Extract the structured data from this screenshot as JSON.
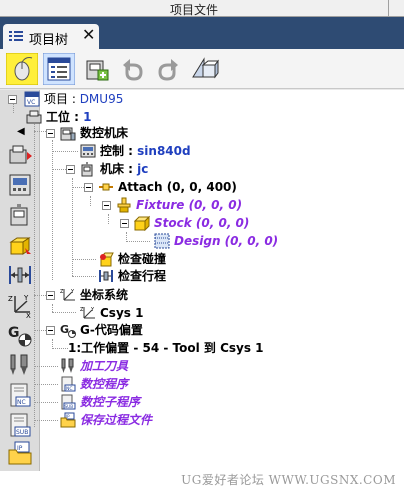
{
  "header": {
    "title": "项目文件"
  },
  "tab": {
    "label": "项目树",
    "close": "✕"
  },
  "toolbar": {
    "buttons": [
      "select-mouse",
      "properties",
      "add-machine",
      "undo",
      "redo",
      "export-3d"
    ]
  },
  "tree": {
    "project": {
      "label": "项目 : ",
      "value": "DMU95"
    },
    "station": {
      "label": "工位 : ",
      "value": "1"
    },
    "cnc_machine": {
      "label": "数控机床"
    },
    "control": {
      "label": "控制 : ",
      "value": "sin840d"
    },
    "machine": {
      "label": "机床 : ",
      "value": "jc"
    },
    "attach": {
      "label": "Attach (0, 0, 400)"
    },
    "fixture": {
      "label": "Fixture (0, 0, 0)"
    },
    "stock": {
      "label": "Stock (0, 0, 0)"
    },
    "design": {
      "label": "Design (0, 0, 0)"
    },
    "collision_check": {
      "label": "检查碰撞"
    },
    "travel_check": {
      "label": "检查行程"
    },
    "coord_system": {
      "label": "坐标系统"
    },
    "csys1": {
      "label": "Csys 1"
    },
    "gcode_offset": {
      "label": "G-代码偏置"
    },
    "work_offset": {
      "label": "1:工作偏置 - 54 - Tool 到 Csys 1"
    },
    "tools": {
      "label": "加工刀具"
    },
    "nc_program": {
      "label": "数控程序"
    },
    "nc_subprogram": {
      "label": "数控子程序"
    },
    "saved_process": {
      "label": "保存过程文件"
    }
  },
  "watermark": {
    "text": "UG爱好者论坛 WWW.UGSNX.COM"
  },
  "colors": {
    "tabbar": "#2e4b73",
    "link_blue": "#1f3fbf",
    "italic_purple": "#8a2be2",
    "active_button": "#ffef3a"
  }
}
